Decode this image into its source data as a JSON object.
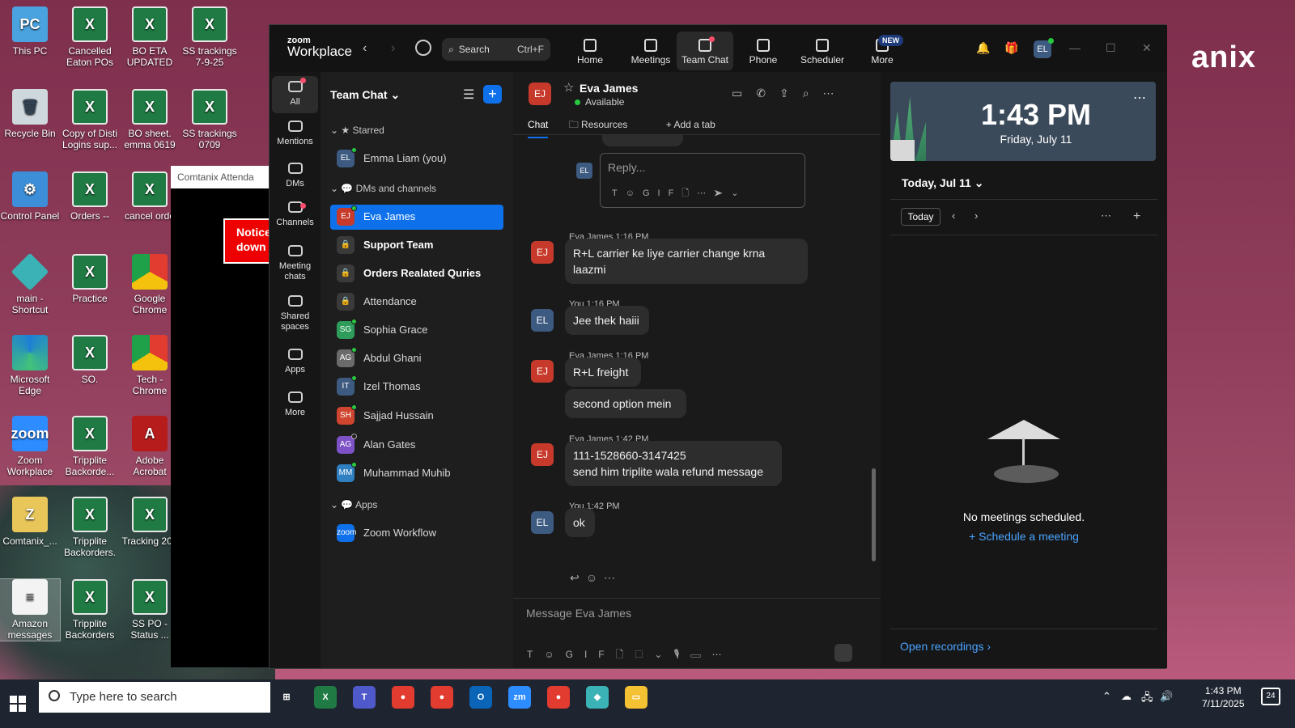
{
  "desktop": {
    "brand_fragment": "anix",
    "icons": [
      {
        "label": "This PC",
        "glyph": "PC"
      },
      {
        "label": "Cancelled Eaton POs",
        "glyph": "X"
      },
      {
        "label": "BO ETA UPDATED",
        "glyph": "X"
      },
      {
        "label": "SS trackings 7-9-25",
        "glyph": "X"
      },
      {
        "label": "Recycle Bin",
        "glyph": "🗑"
      },
      {
        "label": "Copy of Disti Logins sup...",
        "glyph": "X"
      },
      {
        "label": "BO sheet. emma 0619",
        "glyph": "X"
      },
      {
        "label": "SS trackings 0709",
        "glyph": "X"
      },
      {
        "label": "Control Panel",
        "glyph": "⚙"
      },
      {
        "label": "Orders --",
        "glyph": "X"
      },
      {
        "label": "cancel orde",
        "glyph": "X"
      },
      {
        "label": "main - Shortcut",
        "glyph": ""
      },
      {
        "label": "Practice",
        "glyph": "X"
      },
      {
        "label": "Google Chrome",
        "glyph": ""
      },
      {
        "label": "Microsoft Edge",
        "glyph": ""
      },
      {
        "label": "SO.",
        "glyph": "X"
      },
      {
        "label": "Tech - Chrome",
        "glyph": ""
      },
      {
        "label": "Zoom Workplace",
        "glyph": "zoom"
      },
      {
        "label": "Tripplite Backorde...",
        "glyph": "X"
      },
      {
        "label": "Adobe Acrobat",
        "glyph": "A"
      },
      {
        "label": "Comtanix_...",
        "glyph": "Z"
      },
      {
        "label": "Tripplite Backorders.",
        "glyph": "X"
      },
      {
        "label": "Tracking 202",
        "glyph": "X"
      },
      {
        "label": "Amazon messages",
        "glyph": "≡"
      },
      {
        "label": "Tripplite Backorders",
        "glyph": "X"
      },
      {
        "label": "SS PO - Status ...",
        "glyph": "X"
      }
    ]
  },
  "bg_window": {
    "title": "Comtanix Attenda",
    "notice": "Notice down"
  },
  "topbar": {
    "logo_line1": "zoom",
    "logo_line2": "Workplace",
    "search_label": "Search",
    "search_shortcut": "Ctrl+F",
    "tabs": [
      {
        "label": "Home",
        "icon": "home-icon"
      },
      {
        "label": "Meetings",
        "icon": "video-icon"
      },
      {
        "label": "Team Chat",
        "icon": "chat-icon"
      },
      {
        "label": "Phone",
        "icon": "phone-icon"
      },
      {
        "label": "Scheduler",
        "icon": "calendar-icon"
      },
      {
        "label": "More",
        "icon": "more-icon"
      }
    ],
    "new_badge": "NEW",
    "user_initials": "EL"
  },
  "rail": {
    "items": [
      {
        "label": "All",
        "icon": "chat-icon"
      },
      {
        "label": "Mentions",
        "icon": "at-icon"
      },
      {
        "label": "DMs",
        "icon": "people-icon"
      },
      {
        "label": "Channels",
        "icon": "hash-icon"
      },
      {
        "label": "Meeting chats",
        "icon": "calendar-icon"
      },
      {
        "label": "Shared spaces",
        "icon": "shared-icon"
      },
      {
        "label": "Apps",
        "icon": "apps-icon"
      },
      {
        "label": "More",
        "icon": "more-icon"
      }
    ]
  },
  "chatlist": {
    "title": "Team Chat",
    "sections": {
      "starred": "Starred",
      "dms": "DMs and channels",
      "apps": "Apps"
    },
    "starred_items": [
      {
        "name": "Emma Liam (you)",
        "initials": "EL",
        "color": "#3d5a80"
      }
    ],
    "items": [
      {
        "name": "Eva James",
        "initials": "EJ",
        "color": "#c73a2b"
      },
      {
        "name": "Support Team",
        "initials": "🔒",
        "color": "#3a3a3a"
      },
      {
        "name": "Orders Realated Quries",
        "initials": "🔒",
        "color": "#3a3a3a"
      },
      {
        "name": "Attendance",
        "initials": "🔒",
        "color": "#3a3a3a"
      },
      {
        "name": "Sophia Grace",
        "initials": "SG",
        "color": "#2e9d5b"
      },
      {
        "name": "Abdul Ghani",
        "initials": "AG",
        "color": "#6b6b6b"
      },
      {
        "name": "Izel Thomas",
        "initials": "IT",
        "color": "#3d5a80"
      },
      {
        "name": "Sajjad Hussain",
        "initials": "SH",
        "color": "#d0452f"
      },
      {
        "name": "Alan Gates",
        "initials": "AG",
        "color": "#7d52c7"
      },
      {
        "name": "Muhammad Muhib",
        "initials": "MM",
        "color": "#2f7fc1"
      }
    ],
    "app_items": [
      {
        "name": "Zoom Workflow",
        "initials": "zoom",
        "color": "#0e71eb"
      }
    ]
  },
  "chat": {
    "contact_initials": "EJ",
    "contact_name": "Eva James",
    "status": "Available",
    "tabs": {
      "chat": "Chat",
      "resources": "Resources",
      "add": "Add a tab"
    },
    "reply_placeholder": "Reply...",
    "reply_initials": "EL",
    "messages": [
      {
        "sender": "Eva James",
        "time": "1:16 PM",
        "initials": "EJ",
        "lines": [
          "R+L carrier ke liye carrier change krna",
          "laazmi"
        ]
      },
      {
        "sender": "You",
        "time": "1:16 PM",
        "initials": "EL",
        "lines": [
          "Jee thek haiii"
        ]
      },
      {
        "sender": "Eva James",
        "time": "1:16 PM",
        "initials": "EJ",
        "lines": [
          "R+L freight"
        ]
      },
      {
        "sender": "",
        "time": "",
        "initials": "",
        "lines": [
          "second option mein"
        ]
      },
      {
        "sender": "Eva James",
        "time": "1:42 PM",
        "initials": "EJ",
        "lines": [
          "111-1528660-3147425",
          "send him triplite wala refund message"
        ]
      },
      {
        "sender": "You",
        "time": "1:42 PM",
        "initials": "EL",
        "lines": [
          "ok"
        ]
      }
    ],
    "composer_placeholder": "Message Eva James"
  },
  "side": {
    "time": "1:43 PM",
    "date": "Friday, July 11",
    "today_heading": "Today, Jul 11",
    "today_button": "Today",
    "no_meetings": "No meetings scheduled.",
    "schedule_link": "Schedule a meeting",
    "recordings_link": "Open recordings"
  },
  "taskbar": {
    "search_placeholder": "Type here to search",
    "time": "1:43 PM",
    "date": "7/11/2025",
    "notifications": "24",
    "apps": [
      {
        "name": "task-view",
        "color": "#1f2530",
        "glyph": "⊞"
      },
      {
        "name": "excel",
        "color": "#1f7a43",
        "glyph": "X"
      },
      {
        "name": "teams",
        "color": "#5059c9",
        "glyph": "T"
      },
      {
        "name": "chrome",
        "color": "#e23b2f",
        "glyph": "●"
      },
      {
        "name": "chrome-profile",
        "color": "#e23b2f",
        "glyph": "●"
      },
      {
        "name": "outlook",
        "color": "#0a64b8",
        "glyph": "O"
      },
      {
        "name": "zoom",
        "color": "#2d8cff",
        "glyph": "zm"
      },
      {
        "name": "chrome-profile-2",
        "color": "#e23b2f",
        "glyph": "●"
      },
      {
        "name": "app",
        "color": "#3bb2b5",
        "glyph": "◆"
      },
      {
        "name": "file-explorer",
        "color": "#f3c131",
        "glyph": "▭"
      }
    ]
  }
}
